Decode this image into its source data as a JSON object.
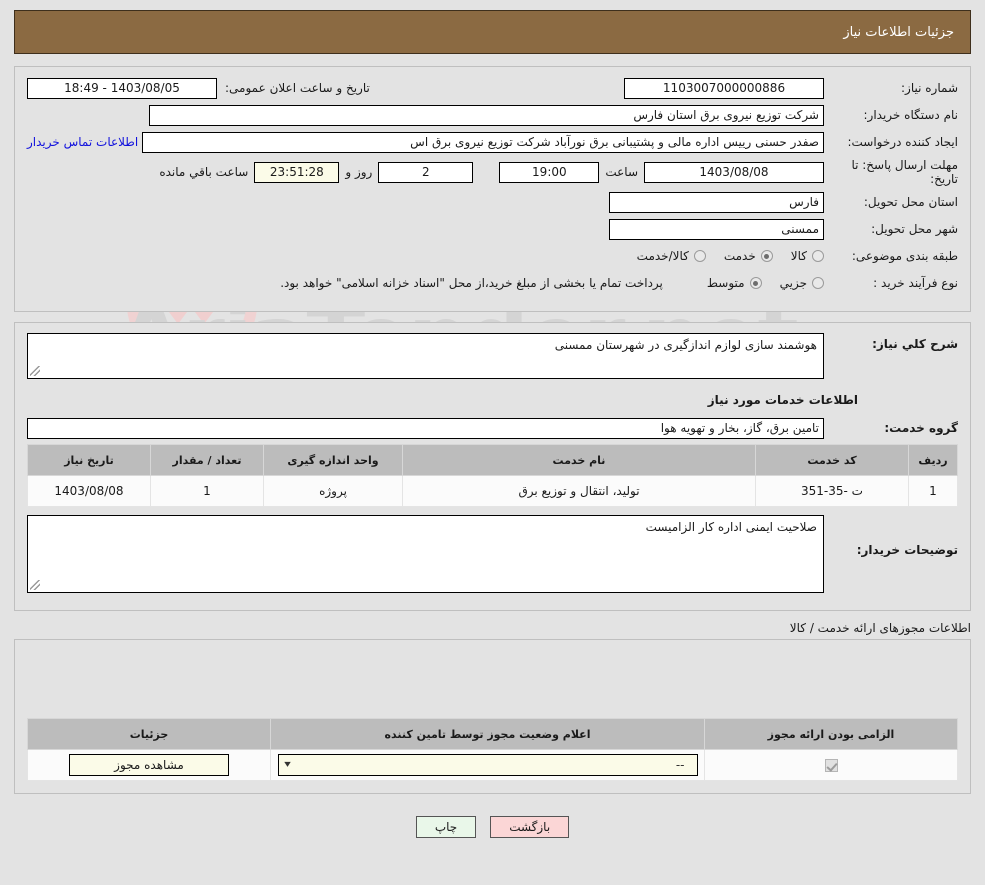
{
  "header": {
    "title": "جزئیات اطلاعات نیاز"
  },
  "form": {
    "need_number_label": "شماره نیاز:",
    "need_number_value": "1103007000000886",
    "announce_label": "تاریخ و ساعت اعلان عمومی:",
    "announce_value": "1403/08/05 - 18:49",
    "buyer_org_label": "نام دستگاه خریدار:",
    "buyer_org_value": "شرکت توزیع نیروی برق استان فارس",
    "creator_label": "ایجاد کننده درخواست:",
    "creator_value": "صفدر حسنی رییس اداره مالی و پشتیبانی برق نورآباد شرکت توزیع نیروی برق اس",
    "contact_link": "اطلاعات تماس خریدار",
    "deadline_label": "مهلت ارسال پاسخ: تا تاریخ:",
    "deadline_date": "1403/08/08",
    "hour_label": "ساعت",
    "deadline_time": "19:00",
    "days_remaining": "2",
    "days_word": "روز و",
    "time_remaining": "23:51:28",
    "remaining_suffix": "ساعت باقي مانده",
    "province_label": "استان محل تحویل:",
    "province_value": "فارس",
    "city_label": "شهر محل تحویل:",
    "city_value": "ممسنی",
    "category_label": "طبقه بندی موضوعی:",
    "category_options": [
      {
        "label": "کالا",
        "selected": false
      },
      {
        "label": "خدمت",
        "selected": true
      },
      {
        "label": "کالا/خدمت",
        "selected": false
      }
    ],
    "process_label": "نوع فرآیند خرید :",
    "process_options": [
      {
        "label": "جزیي",
        "selected": false
      },
      {
        "label": "متوسط",
        "selected": true
      }
    ],
    "payment_note": "پرداخت تمام یا بخشی از مبلغ خرید،از محل \"اسناد خزانه اسلامی\" خواهد بود.",
    "summary_label": "شرح کلي نیاز:",
    "summary_value": "هوشمند سازی لوازم اندازگیری در شهرستان ممسنی",
    "services_info_title": "اطلاعات خدمات مورد نیاز",
    "service_group_label": "گروه خدمت:",
    "service_group_value": "تامین برق، گاز، بخار و تهویه هوا",
    "buyer_notes_label": "توضیحات خریدار:",
    "buyer_notes_value": "صلاحیت ایمنی اداره کار الزامیست"
  },
  "services_table": {
    "columns": [
      "ردیف",
      "کد خدمت",
      "نام خدمت",
      "واحد اندازه گیری",
      "تعداد / مقدار",
      "تاریخ نیاز"
    ],
    "rows": [
      {
        "row_no": "1",
        "service_code": "ت -35-351",
        "service_name": "تولید، انتقال و توزیع برق",
        "unit": "پروژه",
        "quantity": "1",
        "need_date": "1403/08/08"
      }
    ]
  },
  "permits": {
    "section_title": "اطلاعات مجوزهای ارائه خدمت / کالا",
    "columns": [
      "الزامی بودن ارائه مجوز",
      "اعلام وضعیت مجوز توسط تامین کننده",
      "جزئیات"
    ],
    "rows": [
      {
        "required_checked": true,
        "status_value": "--",
        "details_button": "مشاهده مجوز"
      }
    ]
  },
  "footer": {
    "print_label": "چاپ",
    "back_label": "بازگشت"
  },
  "watermark": {
    "text": "AriaTender.net"
  },
  "colors": {
    "header_bg": "#8b6a42",
    "link": "#1111dd",
    "print_btn": "#e9f7e9",
    "back_btn": "#fbd6d6",
    "cream": "#fbfbe8",
    "table_header": "#bcbcbc"
  }
}
